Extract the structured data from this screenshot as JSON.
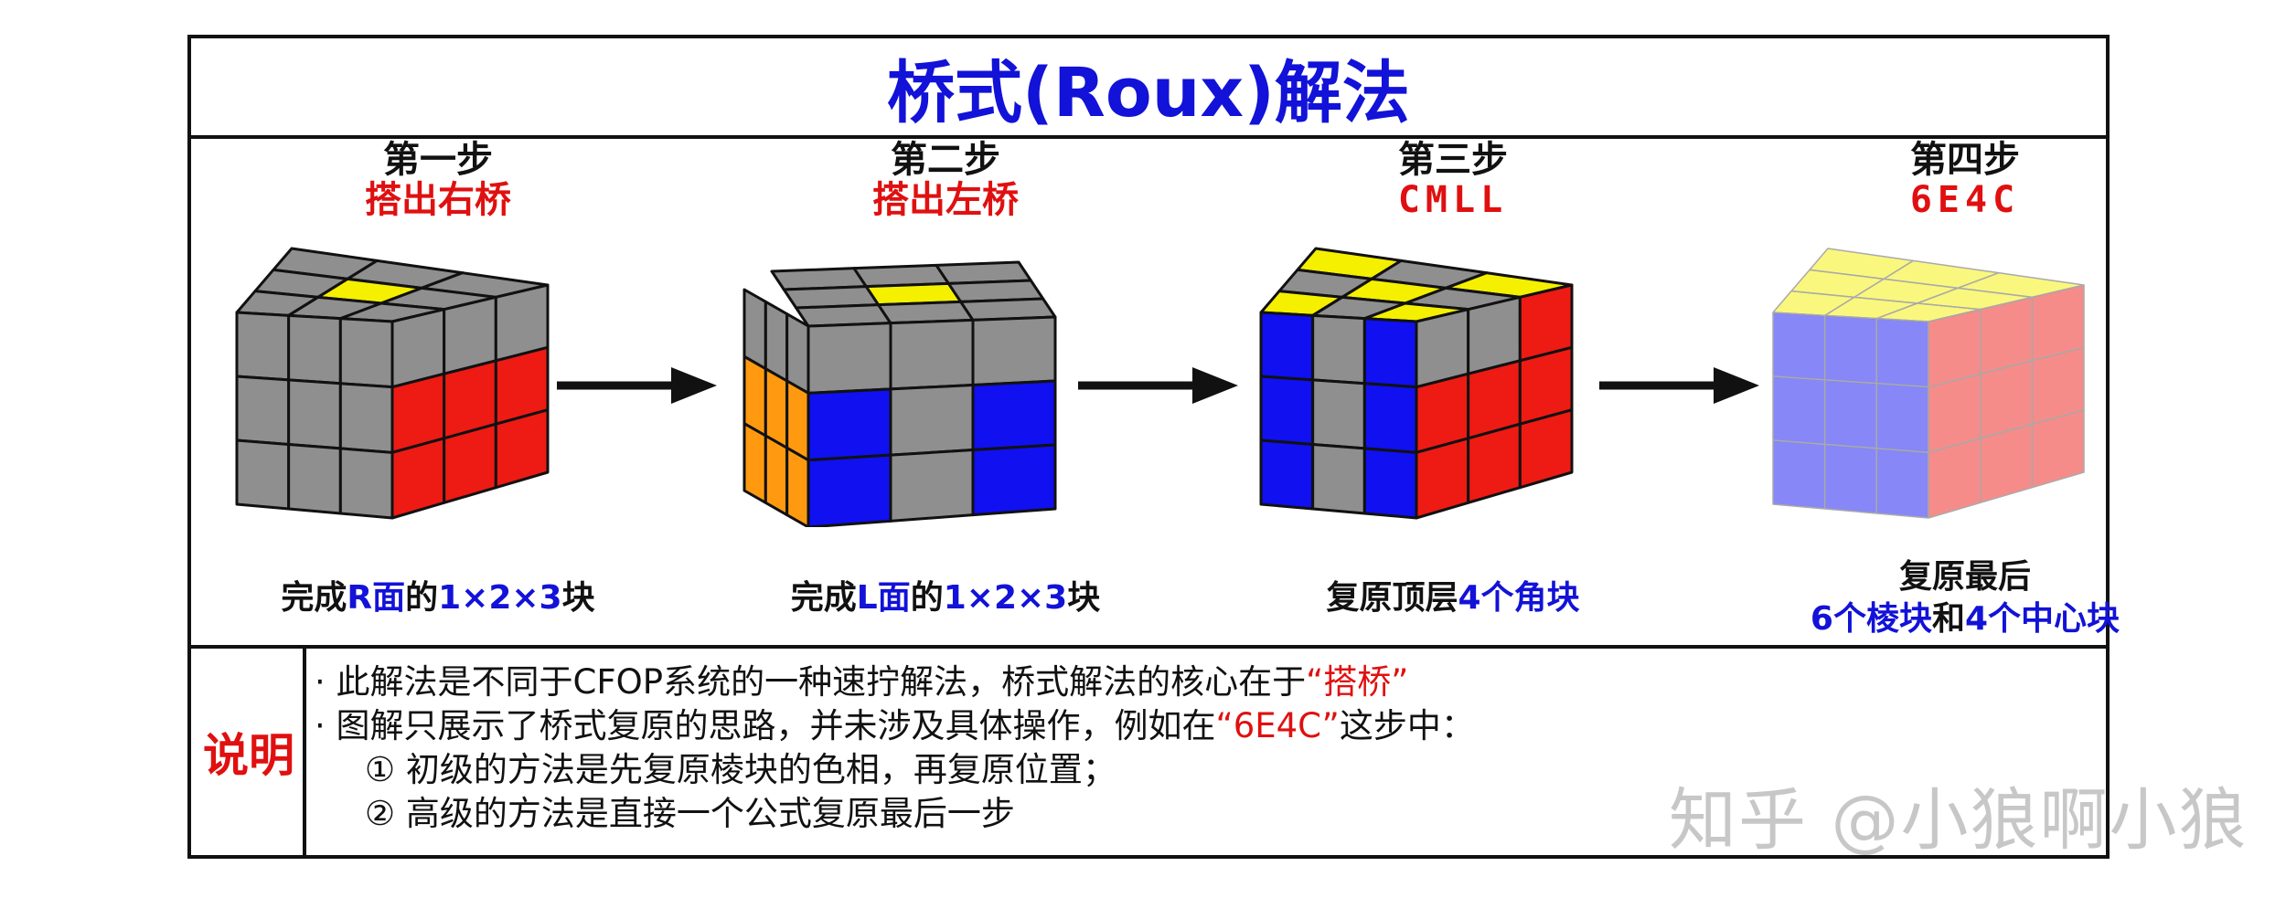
{
  "title": "桥式(Roux)解法",
  "steps": [
    {
      "num": "第一步",
      "name": "搭出右桥",
      "caption": {
        "a": "完成",
        "b": "R面",
        "c": "的",
        "d": "1×2×3",
        "e": "块"
      }
    },
    {
      "num": "第二步",
      "name": "搭出左桥",
      "caption": {
        "a": "完成",
        "b": "L面",
        "c": "的",
        "d": "1×2×3",
        "e": "块"
      }
    },
    {
      "num": "第三步",
      "name": "CMLL",
      "caption": {
        "a": "复原顶层",
        "b": "4个角块"
      }
    },
    {
      "num": "第四步",
      "name": "6E4C",
      "caption": {
        "line1": "复原最后",
        "b": "6个棱块",
        "c": "和",
        "d": "4个中心块"
      }
    }
  ],
  "notes": {
    "label": "说明",
    "line1": {
      "a": "· 此解法是不同于CFOP系统的一种速拧解法，桥式解法的核心在于",
      "b": "“搭桥”"
    },
    "line2": {
      "a": "· 图解只展示了桥式复原的思路，并未涉及具体操作，例如在",
      "b": "“6E4C”",
      "c": "这步中："
    },
    "line3": "① 初级的方法是先复原棱块的色相，再复原位置；",
    "line4": "② 高级的方法是直接一个公式复原最后一步"
  },
  "watermark": "知乎 @小狼啊小狼",
  "colors": {
    "title": "#1212d8",
    "accent_red": "#e01010",
    "cube_gray": "#8f8f8f",
    "cube_yellow": "#f5f000",
    "cube_red": "#ee1a14",
    "cube_blue": "#1010f0",
    "cube_orange": "#ff9a10"
  },
  "cubes": [
    {
      "icon": "rubiks-cube-icon",
      "top": [
        "G",
        "G",
        "G",
        "G",
        "Y",
        "G",
        "G",
        "G",
        "G"
      ],
      "front": [
        "G",
        "G",
        "G",
        "G",
        "G",
        "G",
        "G",
        "G",
        "G"
      ],
      "right": [
        "G",
        "G",
        "G",
        "R",
        "R",
        "R",
        "R",
        "R",
        "R"
      ]
    },
    {
      "icon": "rubiks-cube-icon",
      "top": [
        "G",
        "G",
        "G",
        "G",
        "Y",
        "G",
        "G",
        "G",
        "G"
      ],
      "front": [
        "G",
        "G",
        "G",
        "B",
        "G",
        "B",
        "B",
        "G",
        "B"
      ],
      "left": [
        "G",
        "G",
        "G",
        "O",
        "O",
        "O",
        "O",
        "O",
        "O"
      ]
    },
    {
      "icon": "rubiks-cube-icon",
      "top": [
        "Y",
        "G",
        "Y",
        "G",
        "Y",
        "G",
        "Y",
        "G",
        "Y"
      ],
      "front": [
        "B",
        "G",
        "B",
        "B",
        "G",
        "B",
        "B",
        "G",
        "B"
      ],
      "right": [
        "G",
        "G",
        "R",
        "R",
        "R",
        "R",
        "R",
        "R",
        "R"
      ]
    },
    {
      "icon": "rubiks-cube-icon",
      "faded": true,
      "top": [
        "Y",
        "Y",
        "Y",
        "Y",
        "Y",
        "Y",
        "Y",
        "Y",
        "Y"
      ],
      "front": [
        "B",
        "B",
        "B",
        "B",
        "B",
        "B",
        "B",
        "B",
        "B"
      ],
      "right": [
        "R",
        "R",
        "R",
        "R",
        "R",
        "R",
        "R",
        "R",
        "R"
      ]
    }
  ]
}
